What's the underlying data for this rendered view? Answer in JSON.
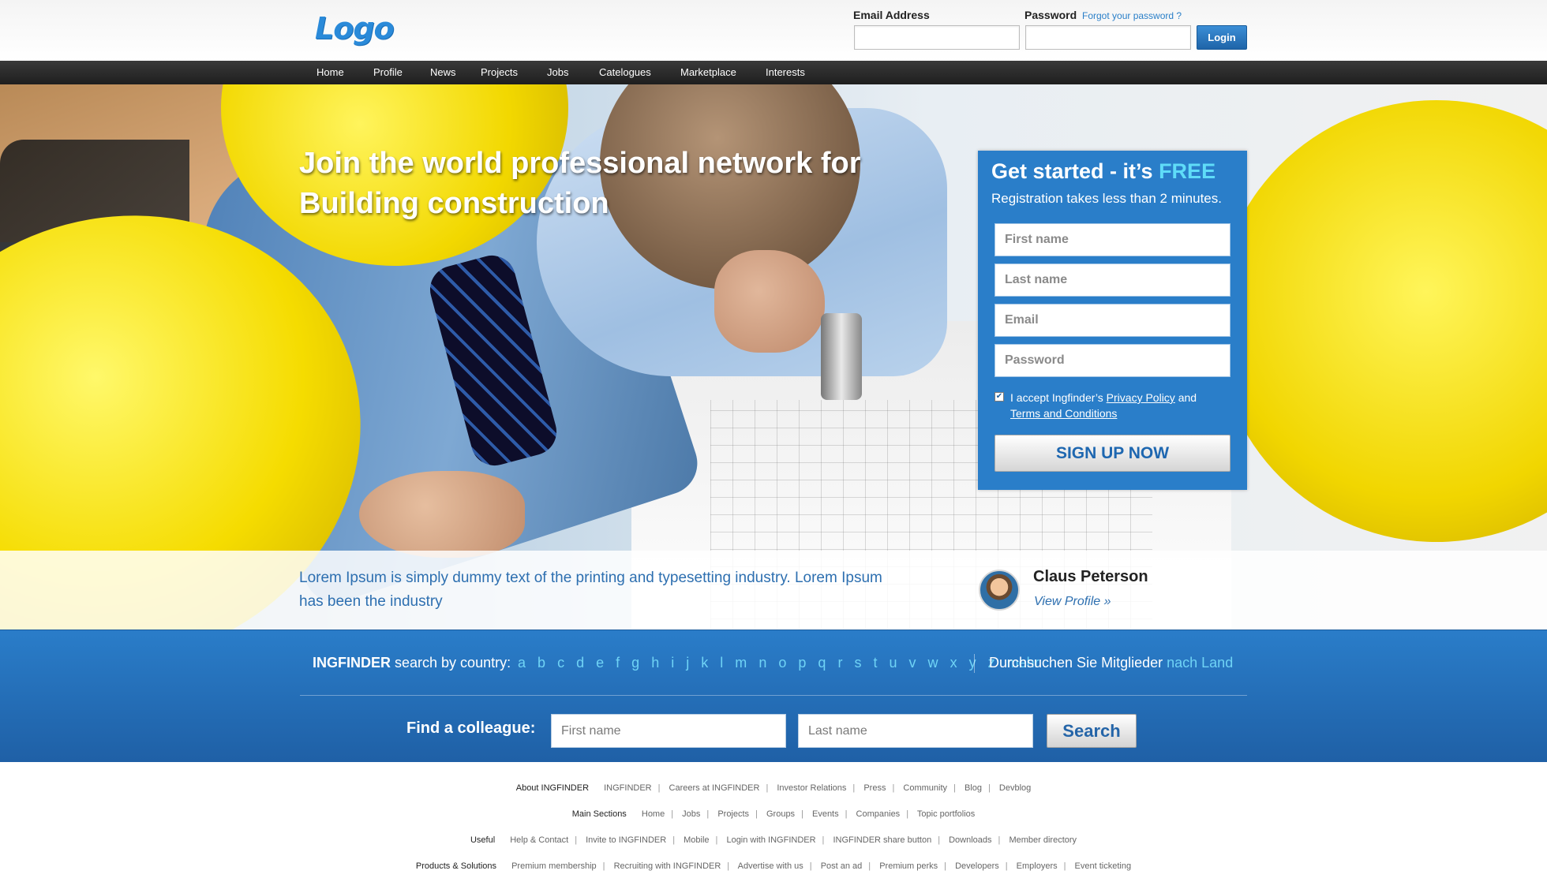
{
  "header": {
    "logo_text": "Logo",
    "email_label": "Email Address",
    "password_label": "Password",
    "forgot_link": "Forgot your password ?",
    "login_button": "Login"
  },
  "nav": {
    "items": [
      "Home",
      "Profile",
      "News",
      "Projects",
      "Jobs",
      "Catelogues",
      "Marketplace",
      "Interests"
    ]
  },
  "hero": {
    "title_line1": "Join the world professional network for",
    "title_line2": "Building construction"
  },
  "signup": {
    "title": "Get started - it’s",
    "title_highlight": "FREE",
    "subtitle": "Registration takes less than 2 minutes.",
    "first_name_placeholder": "First name",
    "last_name_placeholder": "Last name",
    "email_placeholder": "Email",
    "password_placeholder": "Password",
    "terms_prefix": "I accept Ingfinder’s",
    "privacy_link": "Privacy Policy",
    "terms_and": "and",
    "terms_link": "Terms and Conditions",
    "checkbox_checked": true,
    "button": "SIGN UP NOW"
  },
  "strip": {
    "text": "Lorem Ipsum is simply dummy text of the printing and typesetting industry. Lorem Ipsum has been the industry",
    "profile_name": "Claus Peterson",
    "profile_link": "View Profile »"
  },
  "search_band": {
    "brand": "INGFINDER",
    "country_label": "search by country:",
    "letters": [
      "a",
      "b",
      "c",
      "d",
      "e",
      "f",
      "g",
      "h",
      "i",
      "j",
      "k",
      "l",
      "m",
      "n",
      "o",
      "p",
      "q",
      "r",
      "s",
      "t",
      "u",
      "v",
      "w",
      "x",
      "y",
      "z",
      "mehr"
    ],
    "de_text": "Durchsuchen Sie Mitglieder",
    "de_highlight": "nach Land",
    "find_label": "Find a colleague:",
    "first_name_placeholder": "First name",
    "last_name_placeholder": "Last name",
    "search_button": "Search"
  },
  "footer": {
    "rows": [
      {
        "heading": "About INGFINDER",
        "links": [
          "INGFINDER",
          "Careers at INGFINDER",
          "Investor Relations",
          "Press",
          "Community",
          "Blog",
          "Devblog"
        ]
      },
      {
        "heading": "Main Sections",
        "links": [
          "Home",
          "Jobs",
          "Projects",
          "Groups",
          "Events",
          "Companies",
          "Topic portfolios"
        ]
      },
      {
        "heading": "Useful",
        "links": [
          "Help & Contact",
          "Invite to INGFINDER",
          "Mobile",
          "Login with INGFINDER",
          "INGFINDER share button",
          "Downloads",
          "Member directory"
        ]
      },
      {
        "heading": "Products & Solutions",
        "links": [
          "Premium membership",
          "Recruiting with INGFINDER",
          "Advertise with us",
          "Post an ad",
          "Premium perks",
          "Developers",
          "Employers",
          "Event ticketing"
        ]
      }
    ]
  },
  "colors": {
    "brand_blue": "#2a7ec9",
    "highlight_cyan": "#5fdcf8",
    "nav_dark": "#2a2a2a",
    "hero_yellow": "#f2d800"
  }
}
